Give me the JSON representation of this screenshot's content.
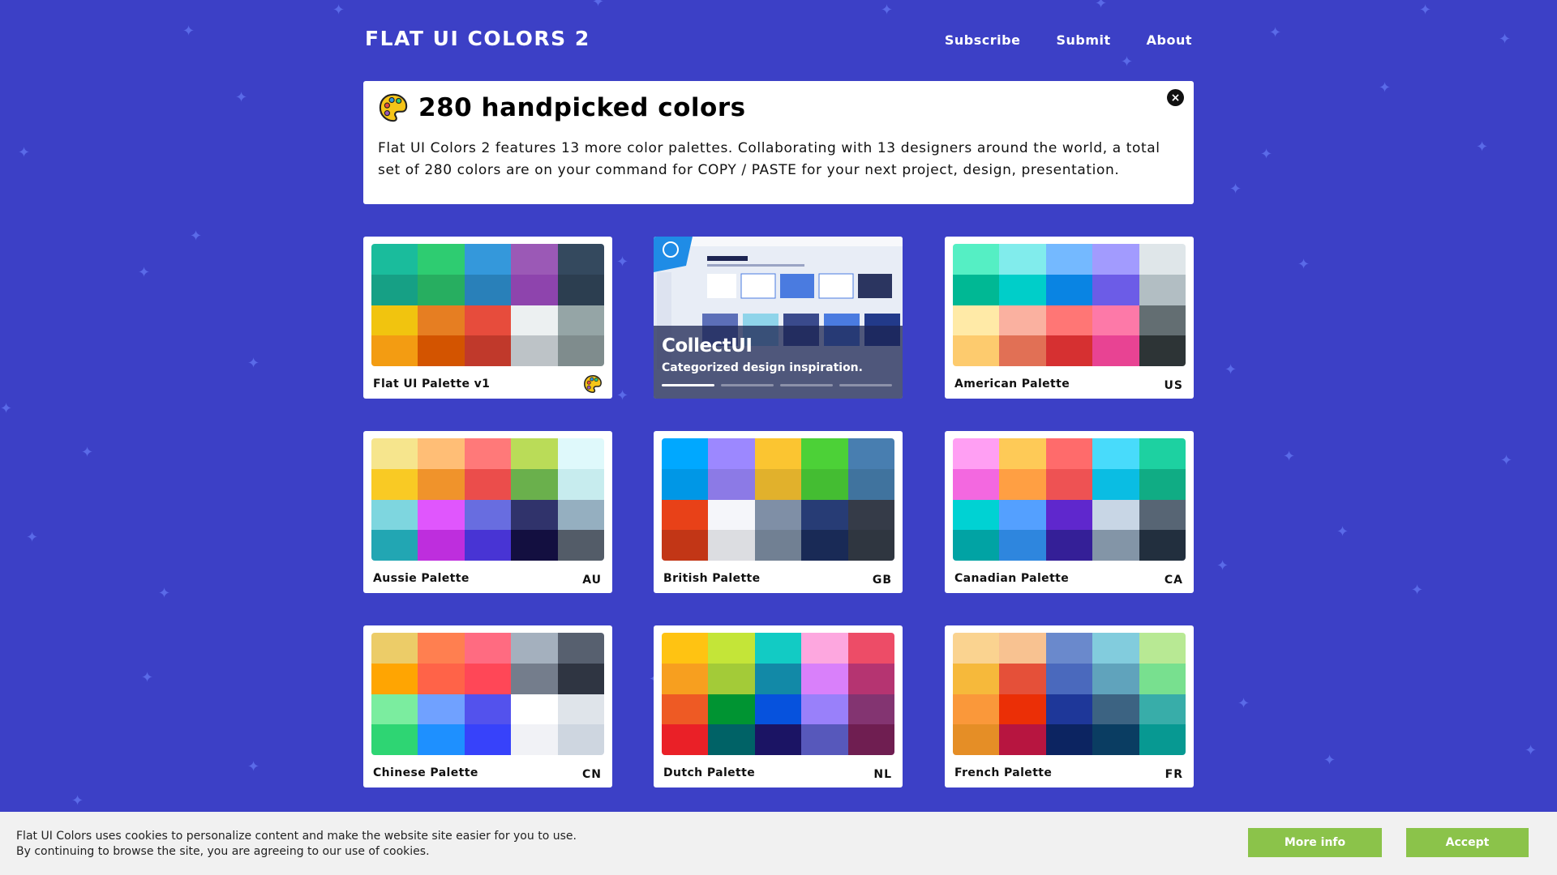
{
  "header": {
    "title": "FLAT UI COLORS 2",
    "nav": [
      "Subscribe",
      "Submit",
      "About"
    ]
  },
  "intro": {
    "heading": "280 handpicked colors",
    "body": "Flat UI Colors 2 features 13 more color palettes. Collaborating with 13 designers around the world, a total set of 280 colors are on your command for COPY / PASTE for your next project, design, presentation."
  },
  "ad": {
    "title": "CollectUI",
    "subtitle": "Categorized design inspiration."
  },
  "palettes": [
    {
      "name": "Flat UI Palette v1",
      "code": "",
      "colors": [
        "#1abc9c",
        "#2ecc71",
        "#3498db",
        "#9b59b6",
        "#34495e",
        "#16a085",
        "#27ae60",
        "#2980b9",
        "#8e44ad",
        "#2c3e50",
        "#f1c40f",
        "#e67e22",
        "#e74c3c",
        "#ecf0f1",
        "#95a5a6",
        "#f39c12",
        "#d35400",
        "#c0392b",
        "#bdc3c7",
        "#7f8c8d"
      ]
    },
    {
      "name": "American Palette",
      "code": "US",
      "colors": [
        "#55efc4",
        "#81ecec",
        "#74b9ff",
        "#a29bfe",
        "#dfe6e9",
        "#00b894",
        "#00cec9",
        "#0984e3",
        "#6c5ce7",
        "#b2bec3",
        "#ffeaa7",
        "#fab1a0",
        "#ff7675",
        "#fd79a8",
        "#636e72",
        "#fdcb6e",
        "#e17055",
        "#d63031",
        "#e84393",
        "#2d3436"
      ]
    },
    {
      "name": "Aussie Palette",
      "code": "AU",
      "colors": [
        "#f6e58d",
        "#ffbe76",
        "#ff7979",
        "#badc58",
        "#dff9fb",
        "#f9ca24",
        "#f0932b",
        "#eb4d4b",
        "#6ab04c",
        "#c7ecee",
        "#7ed6df",
        "#e056fd",
        "#686de0",
        "#30336b",
        "#95afc0",
        "#22a6b3",
        "#be2edd",
        "#4834d4",
        "#130f40",
        "#535c68"
      ]
    },
    {
      "name": "British Palette",
      "code": "GB",
      "colors": [
        "#00a8ff",
        "#9c88ff",
        "#fbc531",
        "#4cd137",
        "#487eb0",
        "#0097e6",
        "#8c7ae6",
        "#e1b12c",
        "#44bd32",
        "#40739e",
        "#e84118",
        "#f5f6fa",
        "#7f8fa6",
        "#273c75",
        "#353b48",
        "#c23616",
        "#dcdde1",
        "#718093",
        "#192a56",
        "#2f3640"
      ]
    },
    {
      "name": "Canadian Palette",
      "code": "CA",
      "colors": [
        "#ff9ff3",
        "#feca57",
        "#ff6b6b",
        "#48dbfb",
        "#1dd1a1",
        "#f368e0",
        "#ff9f43",
        "#ee5253",
        "#0abde3",
        "#10ac84",
        "#00d2d3",
        "#54a0ff",
        "#5f27cd",
        "#c8d6e5",
        "#576574",
        "#01a3a4",
        "#2e86de",
        "#341f97",
        "#8395a7",
        "#222f3e"
      ]
    },
    {
      "name": "Chinese Palette",
      "code": "CN",
      "colors": [
        "#eccc68",
        "#ff7f50",
        "#ff6b81",
        "#a4b0be",
        "#57606f",
        "#ffa502",
        "#ff6348",
        "#ff4757",
        "#747d8c",
        "#2f3542",
        "#7bed9f",
        "#70a1ff",
        "#5352ed",
        "#ffffff",
        "#dfe4ea",
        "#2ed573",
        "#1e90ff",
        "#3742fa",
        "#f1f2f6",
        "#ced6e0"
      ]
    },
    {
      "name": "Dutch Palette",
      "code": "NL",
      "colors": [
        "#ffc312",
        "#c4e538",
        "#12cbc4",
        "#fda7df",
        "#ed4c67",
        "#f79f1f",
        "#a3cb38",
        "#1289a7",
        "#d980fa",
        "#b53471",
        "#ee5a24",
        "#009432",
        "#0652dd",
        "#9980fa",
        "#833471",
        "#ea2027",
        "#006266",
        "#1b1464",
        "#5758bb",
        "#6f1e51"
      ]
    },
    {
      "name": "French Palette",
      "code": "FR",
      "colors": [
        "#fad390",
        "#f8c291",
        "#6a89cc",
        "#82ccdd",
        "#b8e994",
        "#f6b93b",
        "#e55039",
        "#4a69bd",
        "#60a3bc",
        "#78e08f",
        "#fa983a",
        "#eb2f06",
        "#1e3799",
        "#3c6382",
        "#38ada9",
        "#e58e26",
        "#b71540",
        "#0c2461",
        "#0a3d62",
        "#079992"
      ]
    }
  ],
  "cookie": {
    "line1": "Flat UI Colors uses cookies to personalize content and make the website site easier for you to use.",
    "line2": "By continuing to browse the site, you are agreeing to our use of cookies.",
    "more_info": "More info",
    "accept": "Accept"
  }
}
